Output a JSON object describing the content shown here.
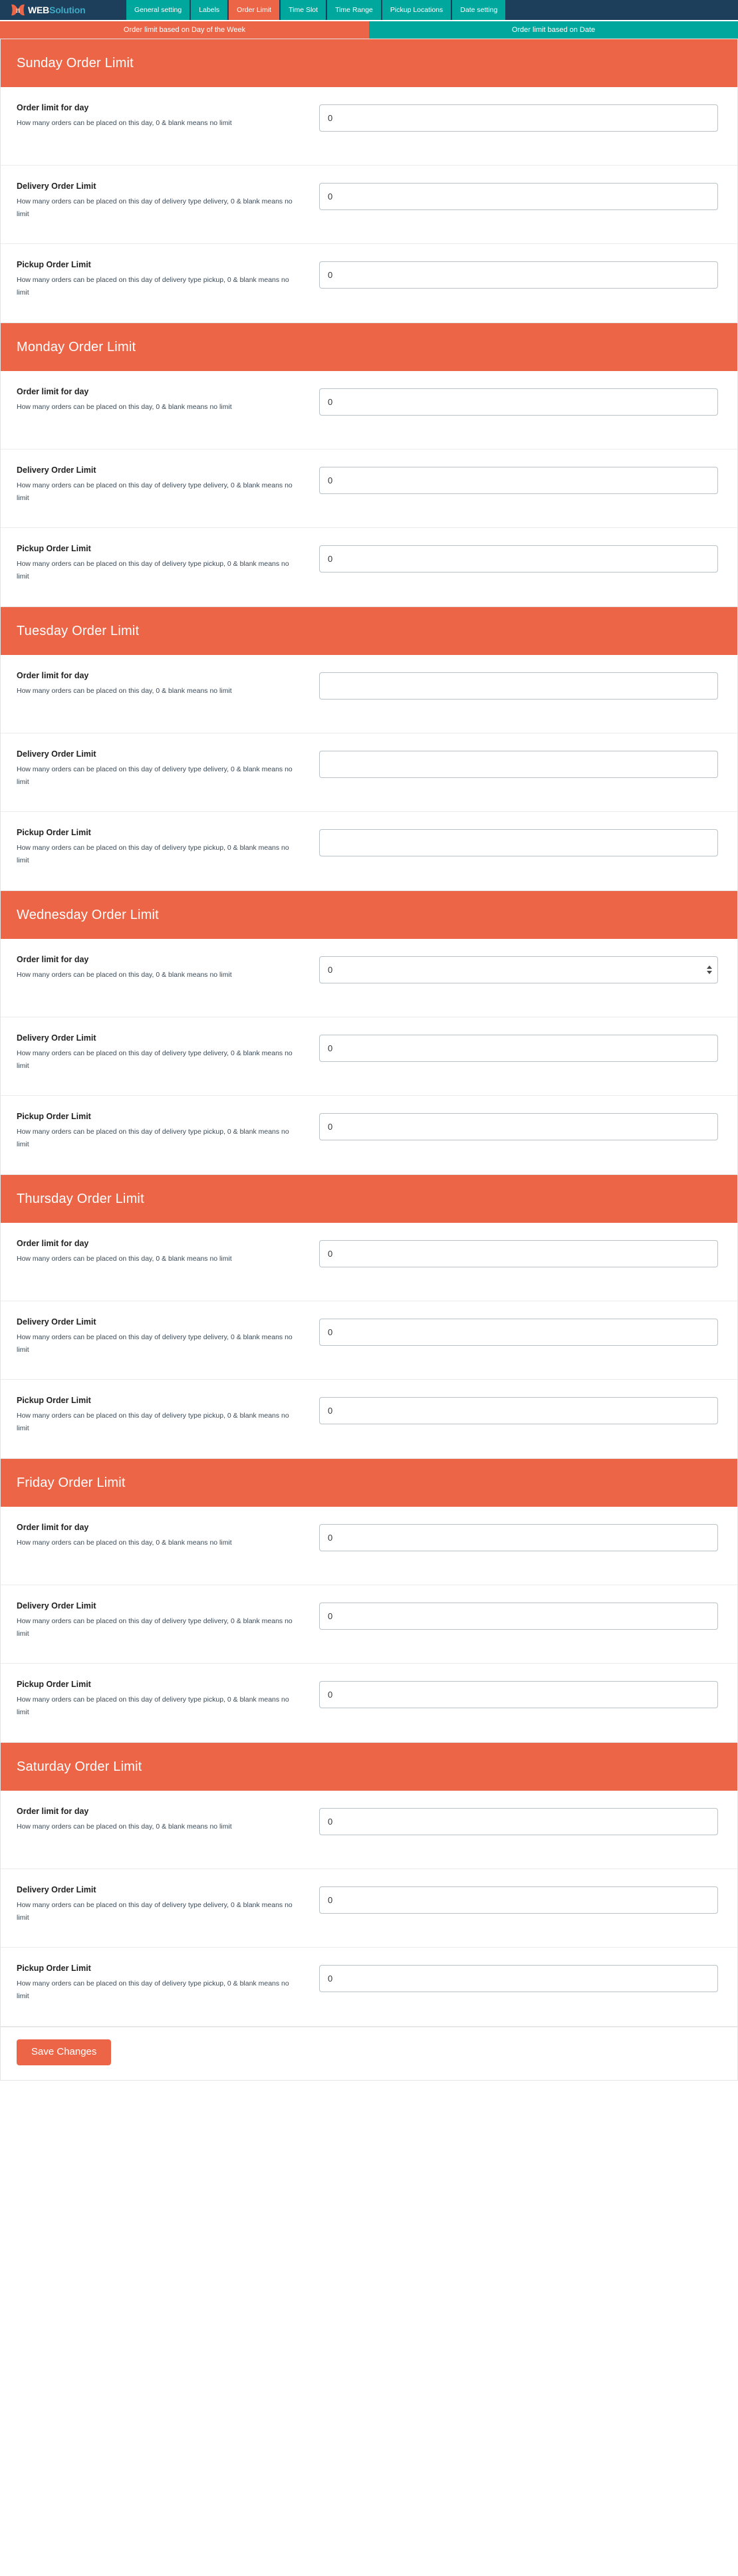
{
  "brand": {
    "logo_icon": "butterfly-pi-logo-icon",
    "name_primary": "WEB",
    "name_secondary": "Solution"
  },
  "colors": {
    "navy": "#1d3f5c",
    "teal": "#00a79d",
    "orange": "#ec6547",
    "brand_accent": "#3ea9c4"
  },
  "nav": {
    "tabs": [
      {
        "label": "General setting",
        "active": false
      },
      {
        "label": "Labels",
        "active": false
      },
      {
        "label": "Order Limit",
        "active": true
      },
      {
        "label": "Time Slot",
        "active": false
      },
      {
        "label": "Time Range",
        "active": false
      },
      {
        "label": "Pickup Locations",
        "active": false
      },
      {
        "label": "Date setting",
        "active": false
      }
    ]
  },
  "subtabs": [
    {
      "label": "Order limit based on Day of the Week",
      "active": true
    },
    {
      "label": "Order limit based on Date",
      "active": false
    }
  ],
  "field_titles": {
    "day": "Order limit for day",
    "delivery": "Delivery Order Limit",
    "pickup": "Pickup Order Limit"
  },
  "field_help": {
    "day": "How many orders can be placed on this day, 0 & blank means no limit",
    "delivery": "How many orders can be placed on this day of delivery type delivery, 0 & blank means no limit",
    "pickup": "How many orders can be placed on this day of delivery type pickup, 0 & blank means no limit"
  },
  "sections": [
    {
      "heading": "Sunday Order Limit",
      "fields": [
        {
          "key": "day",
          "value": "0",
          "spinner": false
        },
        {
          "key": "delivery",
          "value": "0",
          "spinner": false
        },
        {
          "key": "pickup",
          "value": "0",
          "spinner": false
        }
      ]
    },
    {
      "heading": "Monday Order Limit",
      "fields": [
        {
          "key": "day",
          "value": "0",
          "spinner": false
        },
        {
          "key": "delivery",
          "value": "0",
          "spinner": false
        },
        {
          "key": "pickup",
          "value": "0",
          "spinner": false
        }
      ]
    },
    {
      "heading": "Tuesday Order Limit",
      "fields": [
        {
          "key": "day",
          "value": "",
          "spinner": false
        },
        {
          "key": "delivery",
          "value": "",
          "spinner": false
        },
        {
          "key": "pickup",
          "value": "",
          "spinner": false
        }
      ]
    },
    {
      "heading": "Wednesday Order Limit",
      "fields": [
        {
          "key": "day",
          "value": "0",
          "spinner": true
        },
        {
          "key": "delivery",
          "value": "0",
          "spinner": false
        },
        {
          "key": "pickup",
          "value": "0",
          "spinner": false
        }
      ]
    },
    {
      "heading": "Thursday Order Limit",
      "fields": [
        {
          "key": "day",
          "value": "0",
          "spinner": false
        },
        {
          "key": "delivery",
          "value": "0",
          "spinner": false
        },
        {
          "key": "pickup",
          "value": "0",
          "spinner": false
        }
      ]
    },
    {
      "heading": "Friday Order Limit",
      "fields": [
        {
          "key": "day",
          "value": "0",
          "spinner": false
        },
        {
          "key": "delivery",
          "value": "0",
          "spinner": false
        },
        {
          "key": "pickup",
          "value": "0",
          "spinner": false
        }
      ]
    },
    {
      "heading": "Saturday Order Limit",
      "fields": [
        {
          "key": "day",
          "value": "0",
          "spinner": false
        },
        {
          "key": "delivery",
          "value": "0",
          "spinner": false
        },
        {
          "key": "pickup",
          "value": "0",
          "spinner": false
        }
      ]
    }
  ],
  "footer": {
    "save_label": "Save Changes"
  }
}
